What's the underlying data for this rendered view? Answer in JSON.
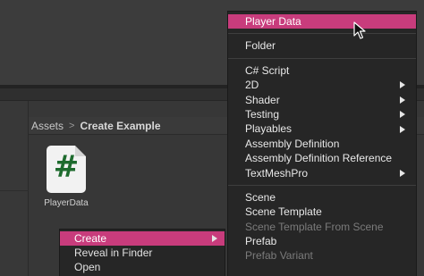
{
  "breadcrumb": {
    "root": "Assets",
    "separator": ">",
    "current": "Create Example"
  },
  "asset": {
    "name": "PlayerData",
    "icon": "csharp-script-icon",
    "icon_glyph": "#"
  },
  "context_menu": {
    "items": [
      {
        "label": "Create",
        "highlighted": true,
        "has_submenu": true
      },
      {
        "label": "Reveal in Finder"
      },
      {
        "label": "Open"
      }
    ]
  },
  "submenu": {
    "player_data": "Player Data",
    "folder": "Folder",
    "csharp_script": "C# Script",
    "two_d": "2D",
    "shader": "Shader",
    "testing": "Testing",
    "playables": "Playables",
    "assembly_definition": "Assembly Definition",
    "assembly_definition_reference": "Assembly Definition Reference",
    "textmeshpro": "TextMeshPro",
    "scene": "Scene",
    "scene_template": "Scene Template",
    "scene_template_from_scene": "Scene Template From Scene",
    "prefab": "Prefab",
    "prefab_variant": "Prefab Variant"
  },
  "colors": {
    "highlight": "#c83c7c",
    "menu_bg": "#262626",
    "icon_hash": "#1e6b2e"
  }
}
